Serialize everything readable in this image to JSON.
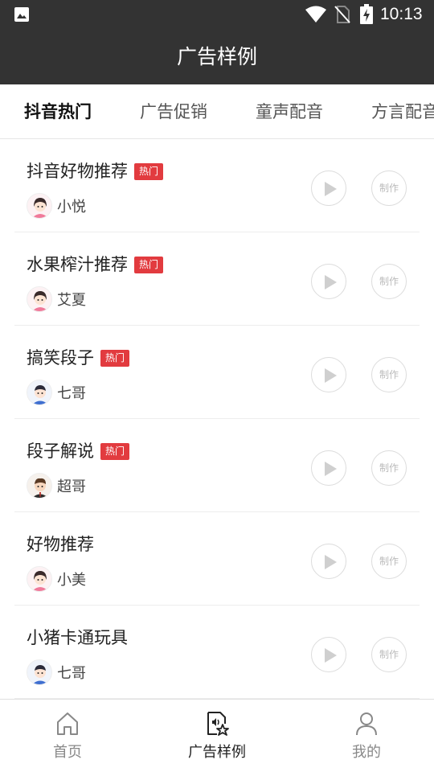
{
  "status_bar": {
    "time": "10:13"
  },
  "header": {
    "title": "广告样例"
  },
  "tabs": [
    {
      "label": "抖音热门",
      "active": true
    },
    {
      "label": "广告促销",
      "active": false
    },
    {
      "label": "童声配音",
      "active": false
    },
    {
      "label": "方言配音",
      "active": false
    }
  ],
  "items": [
    {
      "name": "抖音好物推荐",
      "hot": "热门",
      "voice": "小悦",
      "avatar": "girl-avatar",
      "make": "制作"
    },
    {
      "name": "水果榨汁推荐",
      "hot": "热门",
      "voice": "艾夏",
      "avatar": "girl-avatar",
      "make": "制作"
    },
    {
      "name": "搞笑段子",
      "hot": "热门",
      "voice": "七哥",
      "avatar": "boy-avatar",
      "make": "制作"
    },
    {
      "name": "段子解说",
      "hot": "热门",
      "voice": "超哥",
      "avatar": "man-avatar",
      "make": "制作"
    },
    {
      "name": "好物推荐",
      "hot": null,
      "voice": "小美",
      "avatar": "girl-avatar",
      "make": "制作"
    },
    {
      "name": "小猪卡通玩具",
      "hot": null,
      "voice": "七哥",
      "avatar": "boy-avatar",
      "make": "制作"
    }
  ],
  "bottom_nav": [
    {
      "label": "首页",
      "icon": "home-icon",
      "active": false
    },
    {
      "label": "广告样例",
      "icon": "audio-doc-star-icon",
      "active": true
    },
    {
      "label": "我的",
      "icon": "person-icon",
      "active": false
    }
  ],
  "colors": {
    "header_bg": "#333333",
    "hot_badge": "#e23b3f"
  }
}
